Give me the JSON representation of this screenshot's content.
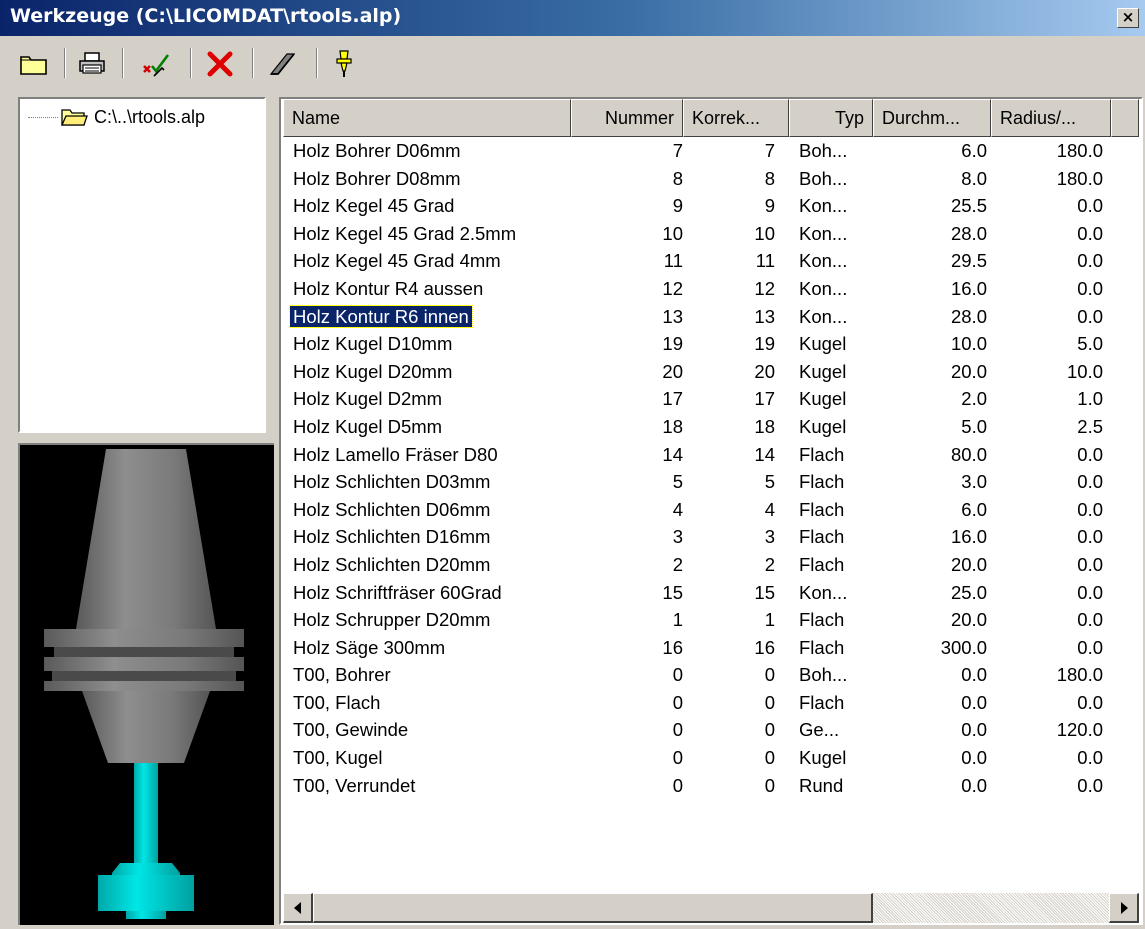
{
  "window": {
    "title": "Werkzeuge (C:\\LICOMDAT\\rtools.alp)",
    "close_glyph": "×"
  },
  "toolbar": {
    "buttons": [
      {
        "name": "open-folder-icon"
      },
      {
        "name": "print-icon"
      },
      {
        "name": "check-tool-icon"
      },
      {
        "name": "delete-icon"
      },
      {
        "name": "edit-icon"
      },
      {
        "name": "tool-holder-icon"
      }
    ]
  },
  "tree": {
    "root_label": "C:\\..\\rtools.alp"
  },
  "colors": {
    "holder": "#7a7a7a",
    "tool": "#00c8c8",
    "selection": "#0a246a"
  },
  "table": {
    "columns": [
      "Name",
      "Nummer",
      "Korrek...",
      "Typ",
      "Durchm...",
      "Radius/..."
    ],
    "rows": [
      [
        "Holz Bohrer D06mm",
        "7",
        "7",
        "Boh...",
        "6.0",
        "180.0"
      ],
      [
        "Holz Bohrer D08mm",
        "8",
        "8",
        "Boh...",
        "8.0",
        "180.0"
      ],
      [
        "Holz Kegel 45 Grad",
        "9",
        "9",
        "Kon...",
        "25.5",
        "0.0"
      ],
      [
        "Holz Kegel 45 Grad 2.5mm",
        "10",
        "10",
        "Kon...",
        "28.0",
        "0.0"
      ],
      [
        "Holz Kegel 45 Grad 4mm",
        "11",
        "11",
        "Kon...",
        "29.5",
        "0.0"
      ],
      [
        "Holz Kontur R4 aussen",
        "12",
        "12",
        "Kon...",
        "16.0",
        "0.0"
      ],
      [
        "Holz Kontur R6 innen",
        "13",
        "13",
        "Kon...",
        "28.0",
        "0.0"
      ],
      [
        "Holz Kugel D10mm",
        "19",
        "19",
        "Kugel",
        "10.0",
        "5.0"
      ],
      [
        "Holz Kugel D20mm",
        "20",
        "20",
        "Kugel",
        "20.0",
        "10.0"
      ],
      [
        "Holz Kugel D2mm",
        "17",
        "17",
        "Kugel",
        "2.0",
        "1.0"
      ],
      [
        "Holz Kugel D5mm",
        "18",
        "18",
        "Kugel",
        "5.0",
        "2.5"
      ],
      [
        "Holz Lamello Fräser D80",
        "14",
        "14",
        "Flach",
        "80.0",
        "0.0"
      ],
      [
        "Holz Schlichten D03mm",
        "5",
        "5",
        "Flach",
        "3.0",
        "0.0"
      ],
      [
        "Holz Schlichten D06mm",
        "4",
        "4",
        "Flach",
        "6.0",
        "0.0"
      ],
      [
        "Holz Schlichten D16mm",
        "3",
        "3",
        "Flach",
        "16.0",
        "0.0"
      ],
      [
        "Holz Schlichten D20mm",
        "2",
        "2",
        "Flach",
        "20.0",
        "0.0"
      ],
      [
        "Holz Schriftfräser 60Grad",
        "15",
        "15",
        "Kon...",
        "25.0",
        "0.0"
      ],
      [
        "Holz Schrupper D20mm",
        "1",
        "1",
        "Flach",
        "20.0",
        "0.0"
      ],
      [
        "Holz Säge 300mm",
        "16",
        "16",
        "Flach",
        "300.0",
        "0.0"
      ],
      [
        "T00, Bohrer",
        "0",
        "0",
        "Boh...",
        "0.0",
        "180.0"
      ],
      [
        "T00, Flach",
        "0",
        "0",
        "Flach",
        "0.0",
        "0.0"
      ],
      [
        "T00, Gewinde",
        "0",
        "0",
        "Ge...",
        "0.0",
        "120.0"
      ],
      [
        "T00, Kugel",
        "0",
        "0",
        "Kugel",
        "0.0",
        "0.0"
      ],
      [
        "T00, Verrundet",
        "0",
        "0",
        "Rund",
        "0.0",
        "0.0"
      ]
    ],
    "selected_index": 6
  }
}
